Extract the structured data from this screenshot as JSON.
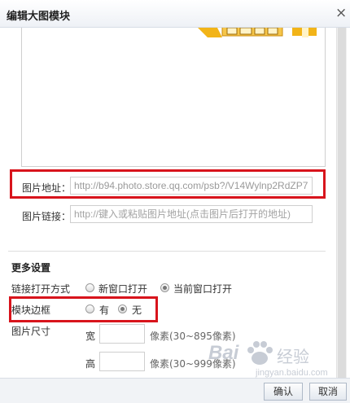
{
  "dialog": {
    "title": "编辑大图模块",
    "close_glyph": "×"
  },
  "image": {
    "url_label": "图片地址：",
    "url_value": "http://b94.photo.store.qq.com/psb?/V14Wylnp2RdZP7",
    "link_label": "图片链接：",
    "link_placeholder": "http://键入或粘贴图片地址(点击图片后打开的地址)"
  },
  "more_settings": {
    "heading": "更多设置",
    "open_mode_label": "链接打开方式",
    "open_mode_options": [
      "新窗口打开",
      "当前窗口打开"
    ],
    "open_mode_selected": 1,
    "border_label": "模块边框",
    "border_options": [
      "有",
      "无"
    ],
    "border_selected": 1,
    "size_label": "图片尺寸",
    "width_label": "宽",
    "width_hint": "像素(30~895像素)",
    "height_label": "高",
    "height_hint": "像素(30~999像素)"
  },
  "footer": {
    "ok_label": "确认",
    "cancel_label": "取消"
  },
  "watermark": {
    "brand_en": "Bai",
    "brand_cn": "经验",
    "url": "jingyan.baidu.com"
  },
  "colors": {
    "highlight_red": "#d8141c",
    "accent_yellow": "#f2b418"
  }
}
